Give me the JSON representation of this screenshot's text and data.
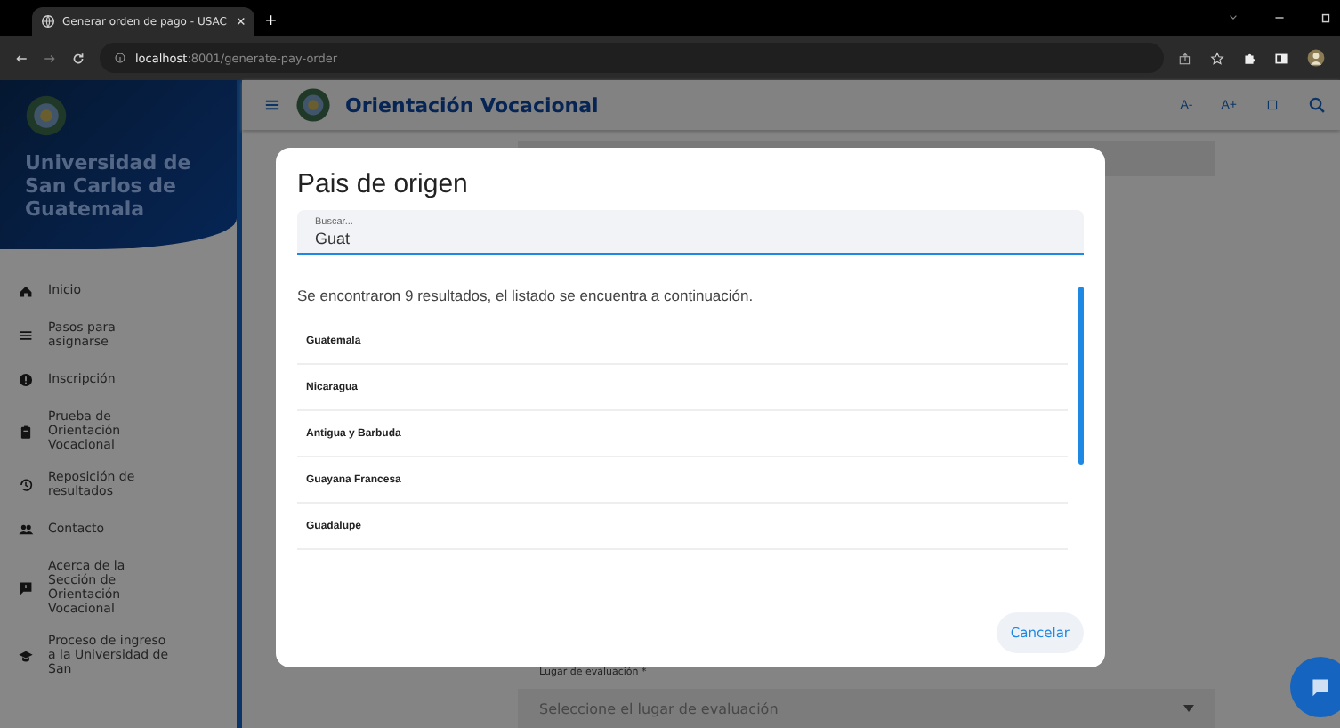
{
  "browser": {
    "tab_title": "Generar orden de pago - USAC",
    "tab_close": "×",
    "new_tab": "+",
    "url_host": "localhost",
    "url_rest": ":8001/generate-pay-order"
  },
  "header": {
    "title": "Orientación Vocacional",
    "font_controls": [
      "A-",
      "A+"
    ]
  },
  "sidebar": {
    "title": "Universidad de San Carlos de Guatemala",
    "items": [
      {
        "kind": "home",
        "label": "Inicio"
      },
      {
        "kind": "list",
        "label": "Pasos para asignarse"
      },
      {
        "kind": "info",
        "label": "Inscripción"
      },
      {
        "kind": "clipboard",
        "label": "Prueba de Orientación Vocacional"
      },
      {
        "kind": "history",
        "label": "Reposición de resultados"
      },
      {
        "kind": "people",
        "label": "Contacto"
      },
      {
        "kind": "feedback",
        "label": "Acerca de la Sección de Orientación Vocacional"
      },
      {
        "kind": "school",
        "label": "Proceso de ingreso a la Universidad de San"
      }
    ]
  },
  "form": {
    "place_label": "Lugar de evaluación *",
    "place_placeholder": "Seleccione el lugar de evaluación"
  },
  "dialog": {
    "title": "Pais de origen",
    "search_label": "Buscar...",
    "search_value": "Guat",
    "message": "Se encontraron 9 resultados, el listado se encuentra a continuación.",
    "results": [
      "Guatemala",
      "Nicaragua",
      "Antigua y Barbuda",
      "Guayana Francesa",
      "Guadalupe"
    ],
    "cancel": "Cancelar"
  }
}
